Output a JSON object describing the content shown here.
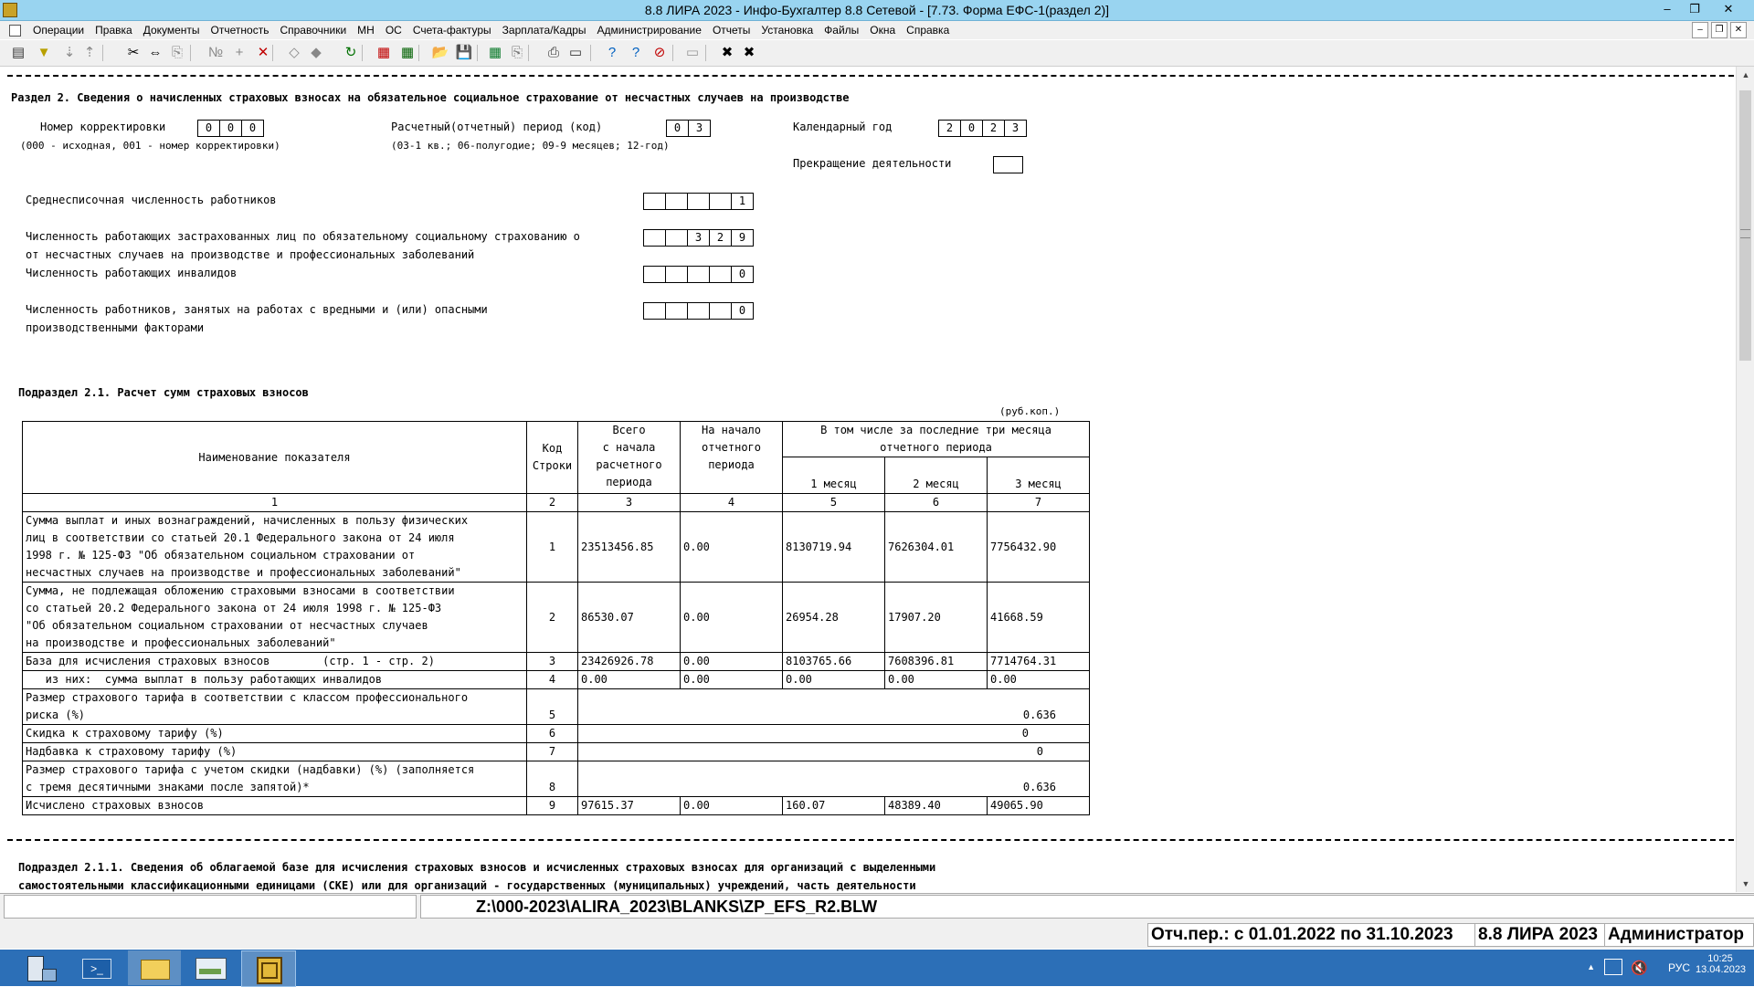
{
  "window": {
    "title": "8.8 ЛИРА 2023 - Инфо-Бухгалтер 8.8 Сетевой - [7.73.    Форма ЕФС-1(раздел 2)]",
    "minimize": "–",
    "restore": "❐",
    "close": "✕"
  },
  "menu": {
    "items": [
      "Операции",
      "Правка",
      "Документы",
      "Отчетность",
      "Справочники",
      "МН",
      "ОС",
      "Счета-фактуры",
      "Зарплата/Кадры",
      "Администрирование",
      "Отчеты",
      "Установка",
      "Файлы",
      "Окна",
      "Справка"
    ]
  },
  "mdi": {
    "minimize": "–",
    "restore": "❐",
    "close": "✕"
  },
  "toolbar": {
    "icons": [
      "view-icon",
      "filter-icon",
      "sort-asc-icon",
      "sort-desc-icon",
      "cut-icon",
      "move-icon",
      "paste-icon",
      "numbering-icon",
      "add-icon",
      "delete-icon",
      "tool-a-icon",
      "tool-b-icon",
      "refresh-icon",
      "pdf-icon",
      "calc-icon",
      "open-icon",
      "save-icon",
      "excel-icon",
      "copy-icon",
      "print-icon",
      "preview-icon",
      "help-icon",
      "context-help-icon",
      "about-icon",
      "keyboard-icon",
      "close-doc-icon",
      "close-all-icon"
    ],
    "glyphs": [
      "▤",
      "▼",
      "⇣",
      "⇡",
      "✂",
      "⇔",
      "⎘",
      "№",
      "+",
      "✕",
      "◇",
      "◆",
      "↻",
      "▦",
      "▦",
      "📂",
      "💾",
      "▦",
      "⎘",
      "⎙",
      "▭",
      "?",
      "?",
      "⊘",
      "▭",
      "✖",
      "✖"
    ],
    "colors": [
      "#333",
      "#b8a000",
      "#888",
      "#888",
      "#000",
      "#000",
      "#888",
      "#888",
      "#888",
      "#c00000",
      "#888",
      "#888",
      "#007000",
      "#c00000",
      "#006000",
      "#c79a00",
      "#1f4fb4",
      "#0a7a2a",
      "#777",
      "#333",
      "#333",
      "#0060c0",
      "#0060c0",
      "#c00000",
      "#999",
      "#000",
      "#000"
    ]
  },
  "section": {
    "title": "Раздел 2. Сведения о начисленных страховых взносах на обязательное социальное страхование от несчастных случаев на производстве",
    "correction_label": "Номер корректировки",
    "correction_cells": [
      "0",
      "0",
      "0"
    ],
    "correction_note": "(000 - исходная, 001 - номер  корректировки)",
    "period_label": "Расчетный(отчетный) период (код)",
    "period_cells": [
      "0",
      "3"
    ],
    "period_note": "(03-1 кв.; 06-полугодие; 09-9 месяцев; 12-год)",
    "year_label": "Календарный год",
    "year_cells": [
      "2",
      "0",
      "2",
      "3"
    ],
    "stop_label": "Прекращение деятельности",
    "stop_cells": [
      ""
    ],
    "avg_label": "Среднесписочная численность работников",
    "avg_cells": [
      "",
      "",
      "",
      "",
      "1"
    ],
    "insured_label_1": "Численность работающих застрахованных лиц по обязательному социальному страхованию о",
    "insured_label_2": "от несчастных случаев на производстве и профессиональных заболеваний",
    "insured_cells": [
      "",
      "",
      "3",
      "2",
      "9"
    ],
    "disabled_label": "Численность работающих инвалидов",
    "disabled_cells": [
      "",
      "",
      "",
      "",
      "0"
    ],
    "hazard_label_1": "Численность работников, занятых на работах с вредными и (или) опасными",
    "hazard_label_2": "производственными факторами",
    "hazard_cells": [
      "",
      "",
      "",
      "",
      "0"
    ]
  },
  "subsection": {
    "title": "Подраздел 2.1. Расчет сумм страховых взносов",
    "units": "(руб.коп.)",
    "headers": {
      "name": "Наименование показателя",
      "code_1": "Код",
      "code_2": "Строки",
      "total_1": "Всего",
      "total_2": "с начала",
      "total_3": "расчетного",
      "total_4": "периода",
      "start_1": "На начало",
      "start_2": "отчетного",
      "start_3": "периода",
      "last3_1": "В том числе за последние три месяца",
      "last3_2": "отчетного периода",
      "m1": "1 месяц",
      "m2": "2 месяц",
      "m3": "3 месяц",
      "nums": [
        "1",
        "2",
        "3",
        "4",
        "5",
        "6",
        "7"
      ]
    },
    "rows": [
      {
        "name": [
          "Сумма выплат и иных вознаграждений, начисленных в пользу физических",
          "лиц в соответствии со статьей 20.1 Федерального закона от 24 июля",
          "1998 г. № 125-ФЗ \"Об обязательном социальном страховании от",
          "несчастных случаев на производстве и профессиональных заболеваний\""
        ],
        "code": "1",
        "total": "23513456.85",
        "start": "0.00",
        "m1": "8130719.94",
        "m2": "7626304.01",
        "m3": "7756432.90"
      },
      {
        "name": [
          "Сумма, не подлежащая обложению страховыми взносами в соответствии",
          "со статьей 20.2 Федерального закона от 24 июля 1998 г. № 125-ФЗ",
          "\"Об обязательном социальном страховании от несчастных случаев",
          "на производстве и профессиональных заболеваний\""
        ],
        "code": "2",
        "total": "86530.07",
        "start": "0.00",
        "m1": "26954.28",
        "m2": "17907.20",
        "m3": "41668.59"
      },
      {
        "name": [
          "База для исчисления страховых взносов        (стр. 1 - стр. 2)"
        ],
        "code": "3",
        "total": "23426926.78",
        "start": "0.00",
        "m1": "8103765.66",
        "m2": "7608396.81",
        "m3": "7714764.31"
      },
      {
        "name": [
          "   из них:  сумма выплат в пользу работающих инвалидов"
        ],
        "code": "4",
        "total": "0.00",
        "start": "0.00",
        "m1": "0.00",
        "m2": "0.00",
        "m3": "0.00"
      }
    ],
    "tariff_rows": [
      {
        "name": [
          "Размер страхового тарифа в соответствии с классом профессионального",
          "риска (%)"
        ],
        "code": "5",
        "value": "0.636"
      },
      {
        "name": [
          "Скидка к страховому тарифу (%)"
        ],
        "code": "6",
        "value": "0"
      },
      {
        "name": [
          "Надбавка к страховому тарифу (%)"
        ],
        "code": "7",
        "value": "0"
      },
      {
        "name": [
          "Размер страхового тарифа с учетом скидки (надбавки) (%) (заполняется",
          "с тремя десятичными знаками после запятой)*"
        ],
        "code": "8",
        "value": "0.636"
      }
    ],
    "last_row": {
      "name": "Исчислено страховых взносов",
      "code": "9",
      "total": "97615.37",
      "start": "0.00",
      "m1": "160.07",
      "m2": "48389.40",
      "m3": "49065.90"
    }
  },
  "subsection_211": {
    "line1": "Подраздел 2.1.1. Сведения об облагаемой базе для исчисления страховых взносов и исчисленных страховых взносах для организаций с выделенными",
    "line2": "самостоятельными классификационными единицами (СКЕ) или для организаций - государственных (муниципальных) учреждений, часть деятельности"
  },
  "status": {
    "path": "Z:\\000-2023\\ALIRA_2023\\BLANKS\\ZP_EFS_R2.BLW",
    "period": "Отч.пер.: с 01.01.2022 по 31.10.2023",
    "product": "8.8 ЛИРА 2023",
    "user": "Администратор"
  },
  "taskbar": {
    "icons": [
      "server-manager-icon",
      "powershell-icon",
      "explorer-icon",
      "photos-icon",
      "lira-app-icon"
    ],
    "lang": "РУС",
    "time": "10:25",
    "date": "13.04.2023"
  }
}
